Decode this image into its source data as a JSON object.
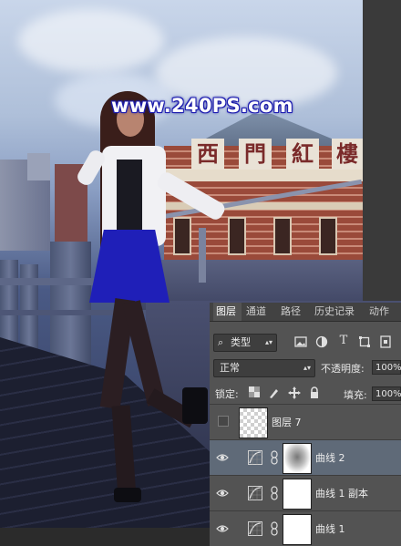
{
  "watermark": "www.240PS.com",
  "photo": {
    "sign_chars": [
      "西",
      "門",
      "紅",
      "樓"
    ]
  },
  "layers_panel": {
    "tabs": [
      "图层",
      "通道",
      "路径",
      "历史记录",
      "动作"
    ],
    "active_tab": "图层",
    "filter": {
      "kind_label": "类型",
      "icons": [
        "image-filter-icon",
        "adjustment-filter-icon",
        "type-filter-icon",
        "shape-filter-icon",
        "smart-object-filter-icon"
      ]
    },
    "blend_mode": "正常",
    "opacity_label": "不透明度:",
    "opacity_value": "100%",
    "lock_label": "锁定:",
    "fill_label": "填充:",
    "fill_value": "100%",
    "layers": [
      {
        "name": "图层 7",
        "visible": false,
        "type": "pixel",
        "selected": false
      },
      {
        "name": "曲线 2",
        "visible": true,
        "type": "curves",
        "selected": true
      },
      {
        "name": "曲线 1 副本",
        "visible": true,
        "type": "curves",
        "selected": false
      },
      {
        "name": "曲线 1",
        "visible": true,
        "type": "curves",
        "selected": false
      }
    ]
  },
  "colors": {
    "panel_bg": "#535353",
    "selected_row": "#5f6a78",
    "skirt": "#1f1fb8",
    "watermark_outline": "#2020c0"
  }
}
